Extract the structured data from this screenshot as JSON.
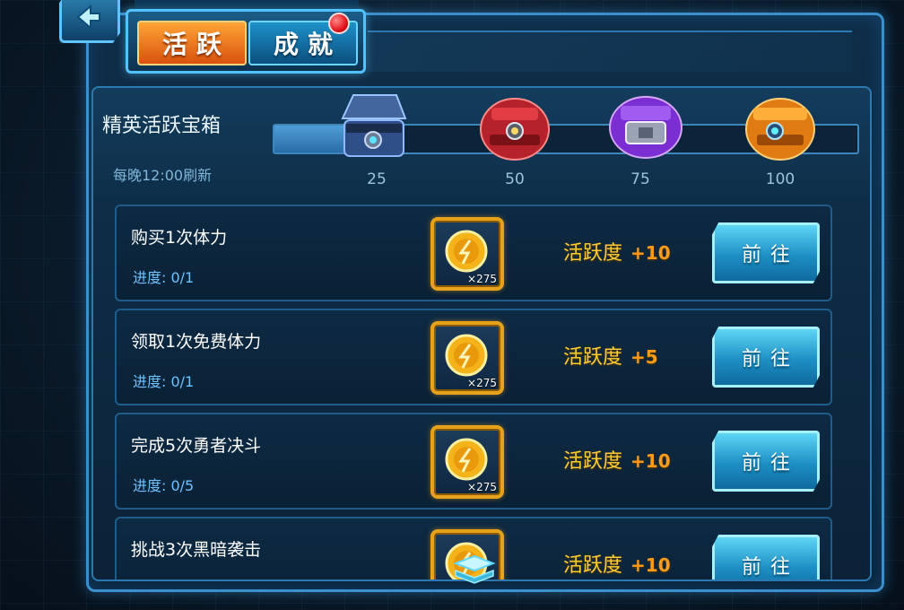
{
  "tabs": {
    "active": "活跃",
    "inactive": "成就"
  },
  "chest_section": {
    "title": "精英活跃宝箱",
    "refresh": "每晚12:00刷新",
    "progress_fraction": 0.12,
    "milestones": [
      {
        "label": "25",
        "color": "#3a5a9c"
      },
      {
        "label": "50",
        "color": "#c8272c"
      },
      {
        "label": "75",
        "color": "#8c3fe0"
      },
      {
        "label": "100",
        "color": "#f08a18"
      }
    ]
  },
  "tasks": [
    {
      "name": "购买1次体力",
      "progress": "进度:  0/1",
      "reward_qty": "×275",
      "activity_label": "活跃度",
      "activity_bonus": "+10",
      "button": "前往"
    },
    {
      "name": "领取1次免费体力",
      "progress": "进度:  0/1",
      "reward_qty": "×275",
      "activity_label": "活跃度",
      "activity_bonus": "+5",
      "button": "前往"
    },
    {
      "name": "完成5次勇者决斗",
      "progress": "进度:  0/5",
      "reward_qty": "×275",
      "activity_label": "活跃度",
      "activity_bonus": "+10",
      "button": "前往"
    },
    {
      "name": "挑战3次黑暗袭击",
      "progress": "",
      "reward_qty": "",
      "activity_label": "活跃度",
      "activity_bonus": "+10",
      "button": "前往"
    }
  ],
  "colors": {
    "accent": "#51c1ff",
    "tab_active": "#ff8a2a",
    "gold": "#e6a21a",
    "activity_text": "#ffcc33"
  }
}
